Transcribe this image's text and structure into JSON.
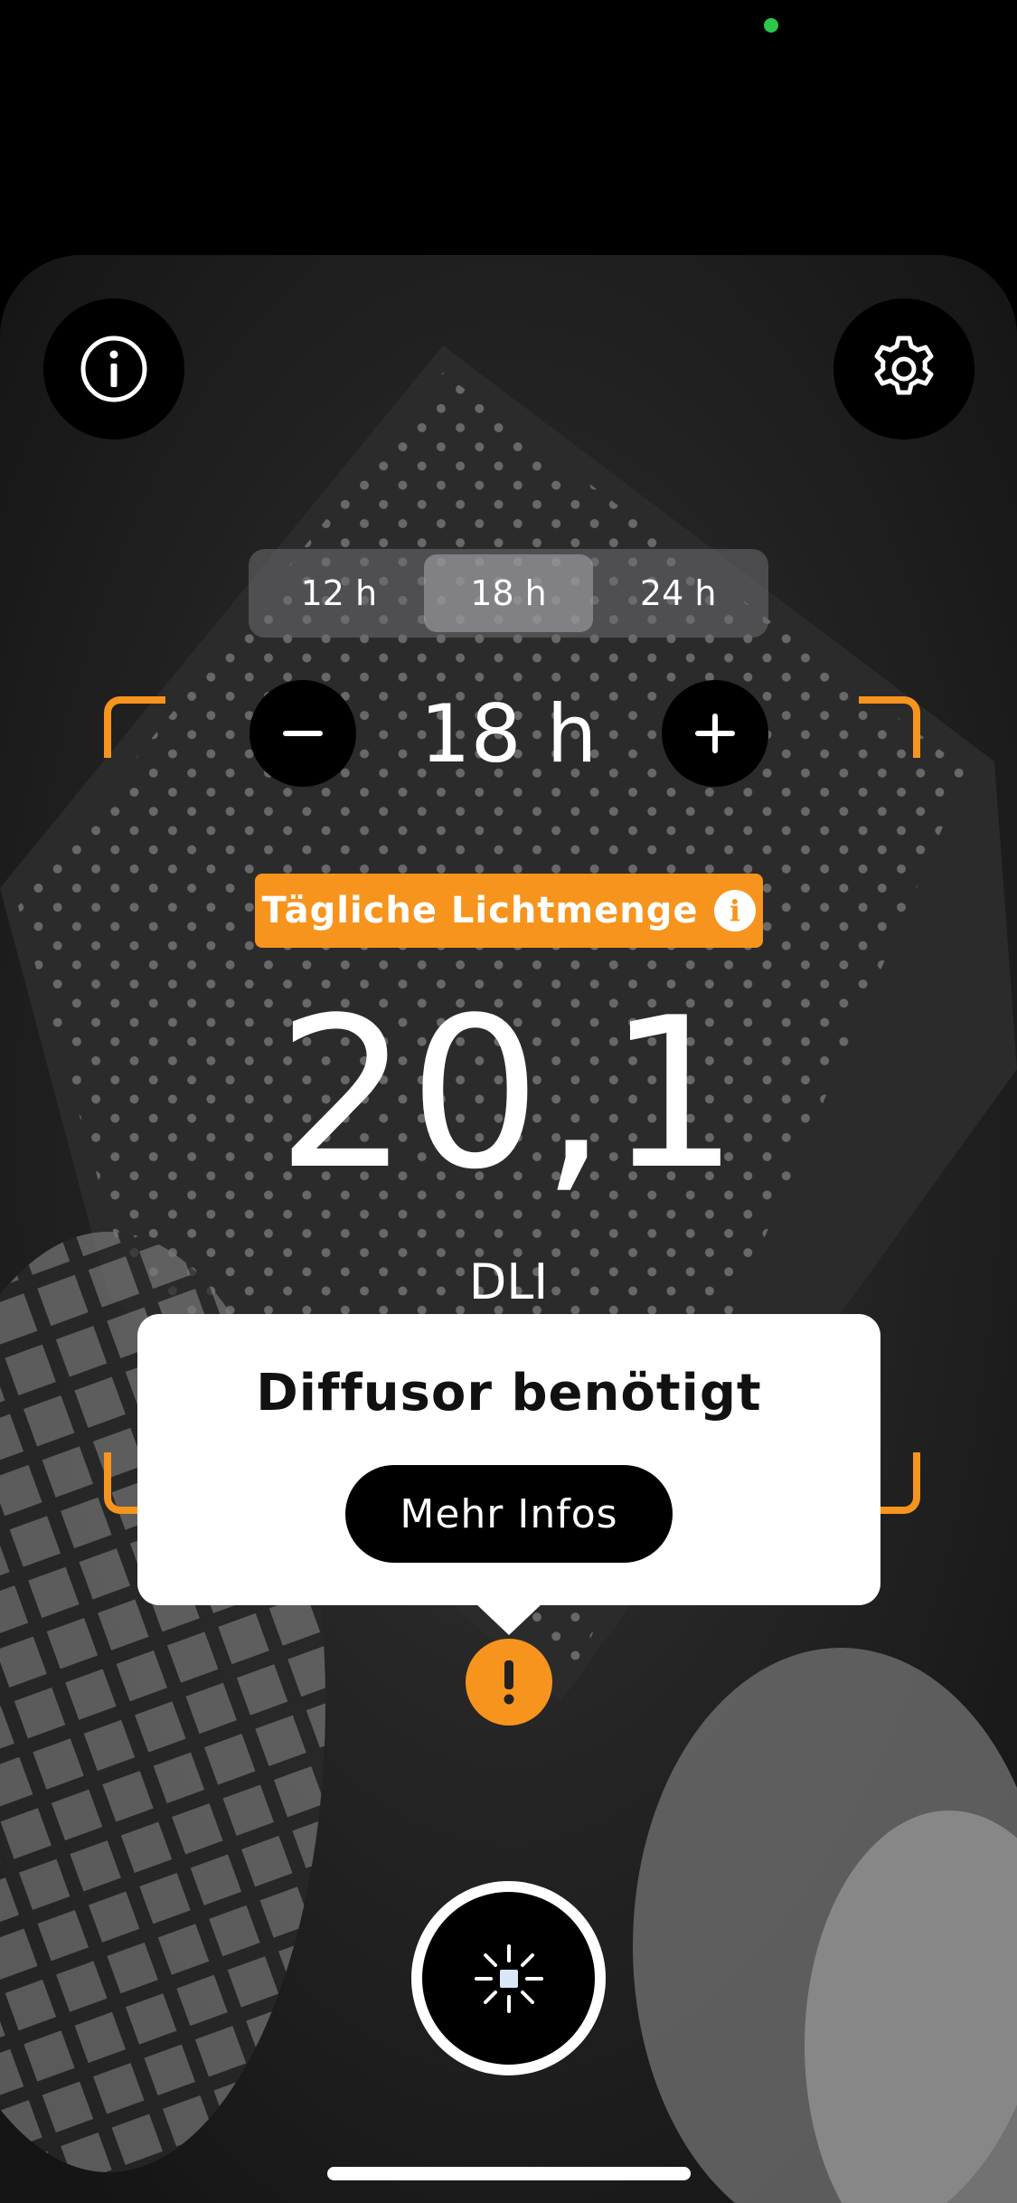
{
  "photoperiod": {
    "options": [
      "12 h",
      "18 h",
      "24 h"
    ],
    "selected": "18 h",
    "current_value": "18 h"
  },
  "daily_light": {
    "label": "Tägliche Lichtmenge",
    "value": "20,1",
    "unit": "DLI"
  },
  "popup": {
    "title": "Diffusor benötigt",
    "button_label": "Mehr Infos"
  },
  "colors": {
    "accent": "#f7941d",
    "status_dot": "#2ac84b"
  },
  "icons": {
    "top_left": "info-icon",
    "top_right": "gear-icon",
    "stepper_decrease": "minus-icon",
    "stepper_increase": "plus-icon",
    "warning": "exclamation-icon",
    "capture": "sun-icon"
  }
}
